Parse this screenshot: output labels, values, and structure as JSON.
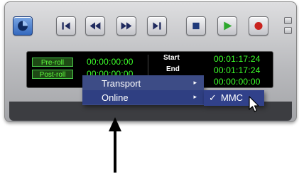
{
  "menu": {
    "items": [
      {
        "label": "Transport",
        "arrow": "▸"
      },
      {
        "label": "Online",
        "arrow": "▸"
      }
    ]
  },
  "submenu": {
    "check": "✓",
    "label": "MMC"
  },
  "counter": {
    "preroll_label": "Pre-roll",
    "postroll_label": "Post-roll",
    "preroll_value": "00:00:00:00",
    "postroll_value": "00:00:00:00",
    "start_label": "Start",
    "end_label": "End",
    "start_value": "00:01:17:24",
    "end_value": "00:01:17:24",
    "length_value": "00:00:00:00"
  },
  "icons": [
    "online-icon",
    "rewind-to-start-icon",
    "rewind-icon",
    "fast-forward-icon",
    "go-to-end-icon",
    "stop-icon",
    "play-icon",
    "record-icon"
  ],
  "colors": {
    "display_green": "#3cff2a",
    "menu_bg": "#3d4c86",
    "play": "#2da82d",
    "record": "#c9241f"
  }
}
